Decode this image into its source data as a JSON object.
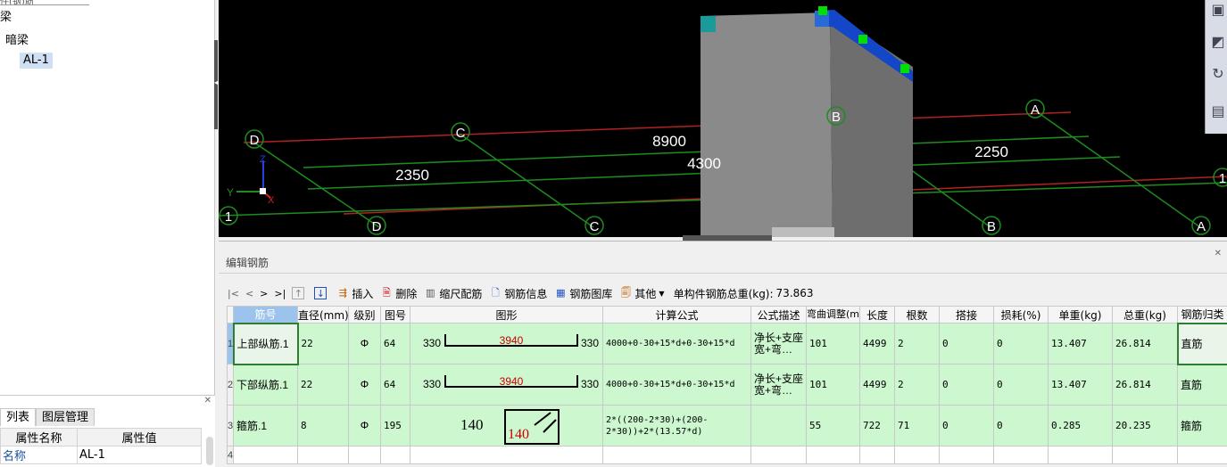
{
  "tree": {
    "search_partial": "件(钢)筋",
    "root_partial": "梁",
    "category": "暗梁",
    "selected_item": "AL-1"
  },
  "props_panel": {
    "tabs": [
      "列表",
      "图层管理"
    ],
    "col_name": "属性名称",
    "col_value": "属性值",
    "rows": [
      {
        "key": "名称",
        "value": "AL-1"
      }
    ]
  },
  "viewport": {
    "axis_labels": {
      "z": "Z",
      "y": "Y",
      "x": "X"
    },
    "grid_bubbles_top": [
      "D",
      "C",
      "B",
      "A"
    ],
    "grid_bubbles_bottom": [
      "D",
      "C",
      "B",
      "A"
    ],
    "grid_bubble_left": "1",
    "grid_bubble_right": "1",
    "dimensions": [
      "8900",
      "4300",
      "2350",
      "2250"
    ],
    "colors": {
      "red_line": "#b22222",
      "green_line": "#1e8c1e",
      "element": "#8c8c8c",
      "beam_top": "#1447c8",
      "grip": "#00e000"
    }
  },
  "panel": {
    "title": "编辑钢筋",
    "toolbar": {
      "nav": [
        "|<",
        "<",
        ">",
        ">|"
      ],
      "insert": "插入",
      "delete": "删除",
      "scale_rebar": "缩尺配筋",
      "rebar_info": "钢筋信息",
      "rebar_library": "钢筋图库",
      "other": "其他",
      "total_weight_label": "单构件钢筋总重(kg):",
      "total_weight_value": "73.863"
    },
    "columns": [
      "筋号",
      "直径(mm)",
      "级别",
      "图号",
      "图形",
      "计算公式",
      "公式描述",
      "弯曲调整(mm)",
      "长度",
      "根数",
      "搭接",
      "损耗(%)",
      "单重(kg)",
      "总重(kg)",
      "钢筋归类"
    ],
    "rows": [
      {
        "idx": "1",
        "name": "上部纵筋.1",
        "dia": "22",
        "grade": "Ф",
        "fig": "64",
        "shape_left": "330",
        "shape_mid": "3940",
        "shape_right": "330",
        "formula": "4000+0-30+15*d+0-30+15*d",
        "desc": "净长+支座宽+弯…",
        "bend": "101",
        "length": "4499",
        "count": "2",
        "lap": "0",
        "loss": "0",
        "unit_w": "13.407",
        "total_w": "26.814",
        "class": "直筋"
      },
      {
        "idx": "2",
        "name": "下部纵筋.1",
        "dia": "22",
        "grade": "Ф",
        "fig": "64",
        "shape_left": "330",
        "shape_mid": "3940",
        "shape_right": "330",
        "formula": "4000+0-30+15*d+0-30+15*d",
        "desc": "净长+支座宽+弯…",
        "bend": "101",
        "length": "4499",
        "count": "2",
        "lap": "0",
        "loss": "0",
        "unit_w": "13.407",
        "total_w": "26.814",
        "class": "直筋"
      },
      {
        "idx": "3",
        "name": "箍筋.1",
        "dia": "8",
        "grade": "Ф",
        "fig": "195",
        "shape_label": "140",
        "shape_box": "140",
        "formula": "2*((200-2*30)+(200-2*30))+2*(13.57*d)",
        "desc": "",
        "bend": "55",
        "length": "722",
        "count": "71",
        "lap": "0",
        "loss": "0",
        "unit_w": "0.285",
        "total_w": "20.235",
        "class": "箍筋"
      }
    ],
    "empty_row_idx": "4"
  }
}
